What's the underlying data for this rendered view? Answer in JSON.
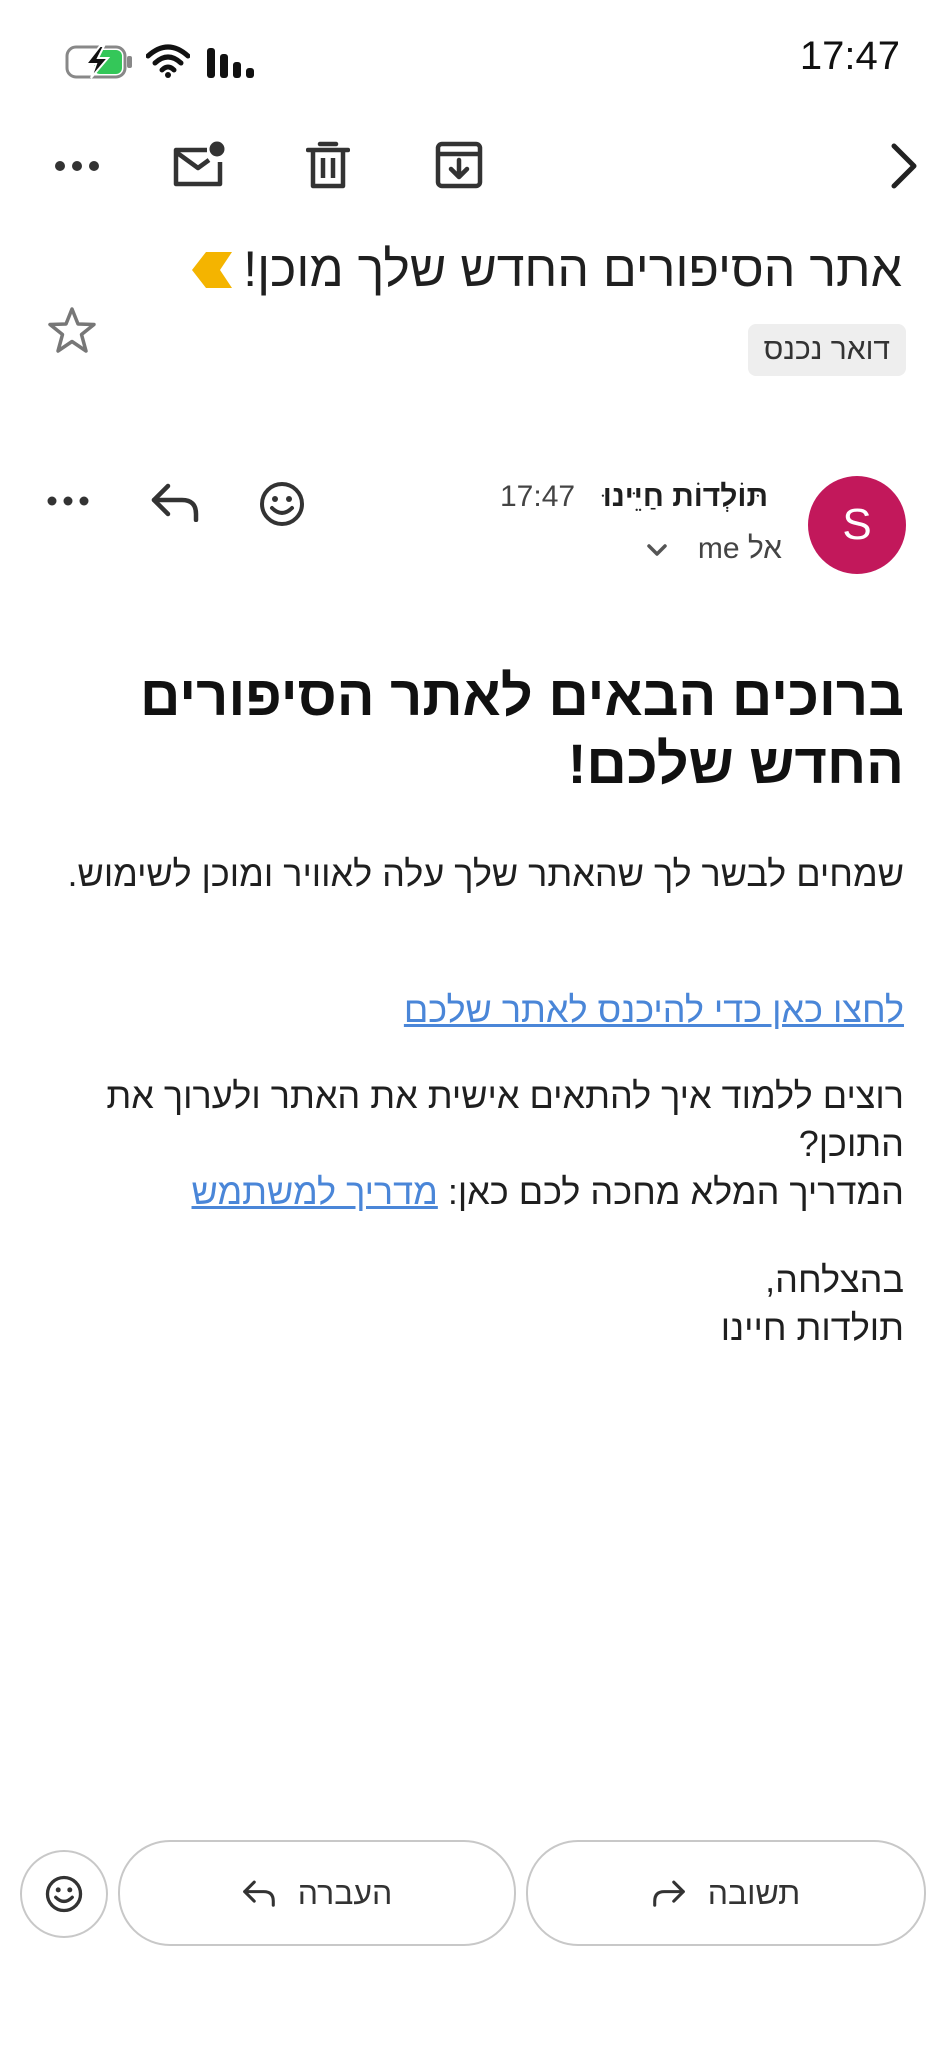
{
  "status_bar": {
    "time": "17:47"
  },
  "toolbar": {
    "more_icon": "more-horiz-icon",
    "mark_unread_icon": "mark-unread-icon",
    "delete_icon": "trash-icon",
    "archive_icon": "archive-icon",
    "forward_nav_icon": "chevron-right-icon"
  },
  "email": {
    "subject": "אתר הסיפורים החדש שלך מוכן!",
    "label": "דואר נכנס",
    "sender": {
      "avatar_letter": "S",
      "name": "תּוֹלְדוֹת חַיֵּינוּ",
      "time": "17:47",
      "recipient": "אל me"
    },
    "body": {
      "headline": "ברוכים הבאים לאתר הסיפורים החדש שלכם!",
      "intro": "שמחים לבשר לך שהאתר שלך עלה לאוויר ומוכן לשימוש.",
      "enter_link": "לחצו כאן כדי להיכנס לאתר שלכם",
      "learn_text": "רוצים ללמוד איך להתאים אישית את האתר ולערוך את התוכן?",
      "guide_prefix": "המדריך המלא מחכה לכם כאן:",
      "guide_link": "מדריך למשתמש",
      "signoff": "בהצלחה,",
      "signature": "תולדות חיינו"
    }
  },
  "bottom_bar": {
    "reply_label": "תשובה",
    "forward_label": "העברה"
  },
  "colors": {
    "avatar": "#c2185b",
    "important_marker": "#f4b400",
    "link": "#4a86d8",
    "battery_fill": "#34c759"
  }
}
